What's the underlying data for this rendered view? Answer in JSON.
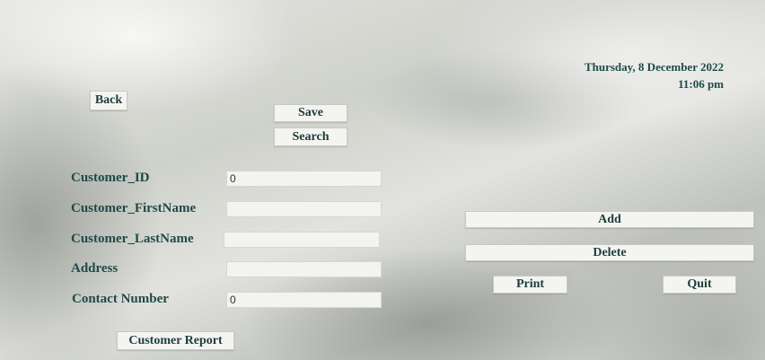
{
  "datetime": {
    "date": "Thursday, 8 December 2022",
    "time": "11:06 pm"
  },
  "buttons": {
    "back": "Back",
    "save": "Save",
    "search": "Search",
    "add": "Add",
    "delete": "Delete",
    "print": "Print",
    "quit": "Quit",
    "customer_report": "Customer Report"
  },
  "form": {
    "customer_id": {
      "label": "Customer_ID",
      "value": "0"
    },
    "first_name": {
      "label": "Customer_FirstName",
      "value": ""
    },
    "last_name": {
      "label": "Customer_LastName",
      "value": ""
    },
    "address": {
      "label": "Address",
      "value": ""
    },
    "contact_number": {
      "label": "Contact Number",
      "value": "0"
    }
  }
}
